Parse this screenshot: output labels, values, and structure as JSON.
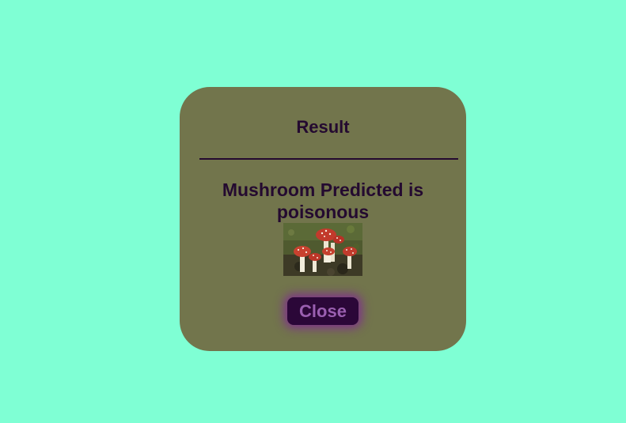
{
  "modal": {
    "title": "Result",
    "message": "Mushroom Predicted is poisonous",
    "image": "fly-agaric-mushrooms-photo",
    "close_label": "Close"
  },
  "colors": {
    "page_background": "#7fffd4",
    "modal_background": "#72754c",
    "text": "#240a30",
    "button_background": "#2b0738",
    "button_text": "#9a5fb0",
    "button_glow": "#8024a0"
  }
}
